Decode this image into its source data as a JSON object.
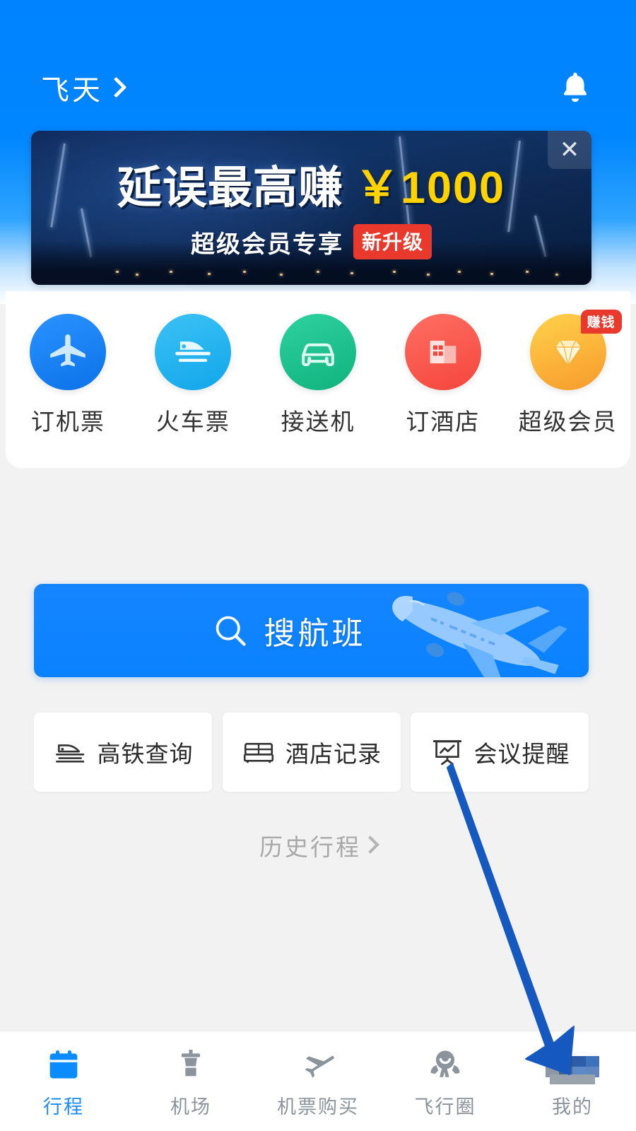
{
  "theme": {
    "brand_blue": "#007fff",
    "accent_blue": "#0a82ff",
    "active_tab_blue": "#1a8cff",
    "badge_red": "#e8392c",
    "amount_yellow": "#ffd200",
    "page_bg": "#f2f2f2",
    "inactive_gray": "#8b949c"
  },
  "header": {
    "brand": "飞天",
    "chevron_icon": "chevron-right-icon",
    "bell_icon": "bell-icon"
  },
  "banner": {
    "headline": "延误最高赚",
    "amount": "￥1000",
    "subtitle": "超级会员专享",
    "badge": "新升级",
    "close_icon": "close-icon"
  },
  "quick_grid": [
    {
      "label": "订机票",
      "icon": "airplane-icon",
      "color": "#1184f0",
      "badge": ""
    },
    {
      "label": "火车票",
      "icon": "train-icon",
      "color": "#22b3f0",
      "badge": ""
    },
    {
      "label": "接送机",
      "icon": "car-icon",
      "color": "#1fc08a",
      "badge": ""
    },
    {
      "label": "订酒店",
      "icon": "hotel-icon",
      "color": "#f9564f",
      "badge": ""
    },
    {
      "label": "超级会员",
      "icon": "diamond-icon",
      "color": "#fbb03b",
      "badge": "赚钱"
    }
  ],
  "search": {
    "label": "搜航班",
    "search_icon": "search-icon",
    "plane_art_icon": "airplane-illustration"
  },
  "shortcuts": [
    {
      "label": "高铁查询",
      "icon": "train-front-icon"
    },
    {
      "label": "酒店记录",
      "icon": "bed-icon"
    },
    {
      "label": "会议提醒",
      "icon": "presentation-board-icon"
    }
  ],
  "history": {
    "label": "历史行程",
    "chevron_icon": "chevron-right-icon"
  },
  "tabbar": [
    {
      "label": "行程",
      "icon": "calendar-icon",
      "active": true
    },
    {
      "label": "机场",
      "icon": "control-tower-icon",
      "active": false
    },
    {
      "label": "机票购买",
      "icon": "airplane-icon",
      "active": false
    },
    {
      "label": "飞行圈",
      "icon": "community-icon",
      "active": false
    },
    {
      "label": "我的",
      "icon": "profile-icon",
      "active": false
    }
  ],
  "annotation": {
    "arrow_icon": "annotation-arrow-icon",
    "color": "#1558c0"
  }
}
